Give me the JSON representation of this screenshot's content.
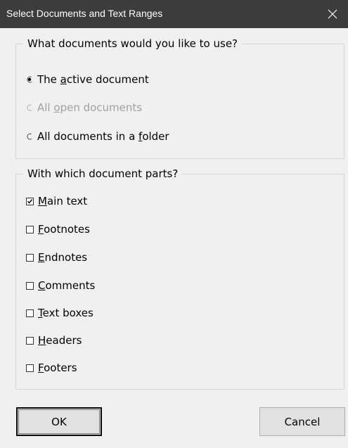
{
  "window": {
    "title": "Select Documents and Text Ranges",
    "close_glyph": "✕"
  },
  "documents_group": {
    "legend": "What documents would you like to use?",
    "options": [
      {
        "pre": "The ",
        "accel": "a",
        "post": "ctive document",
        "selected": true,
        "enabled": true
      },
      {
        "pre": "All ",
        "accel": "o",
        "post": "pen documents",
        "selected": false,
        "enabled": false
      },
      {
        "pre": "All documents in a ",
        "accel": "f",
        "post": "older",
        "selected": false,
        "enabled": true
      }
    ]
  },
  "parts_group": {
    "legend": "With which document parts?",
    "items": [
      {
        "pre": "",
        "accel": "M",
        "post": "ain text",
        "checked": true
      },
      {
        "pre": "",
        "accel": "F",
        "post": "ootnotes",
        "checked": false
      },
      {
        "pre": "",
        "accel": "E",
        "post": "ndnotes",
        "checked": false
      },
      {
        "pre": "",
        "accel": "C",
        "post": "omments",
        "checked": false
      },
      {
        "pre": "",
        "accel": "T",
        "post": "ext boxes",
        "checked": false
      },
      {
        "pre": "",
        "accel": "H",
        "post": "eaders",
        "checked": false
      },
      {
        "pre": "",
        "accel": "F",
        "post": "ooters",
        "checked": false
      }
    ]
  },
  "buttons": {
    "ok_label": "OK",
    "cancel_label": "Cancel"
  },
  "colors": {
    "titlebar": "#3c3c3c",
    "dialog_bg": "#f0f0f0",
    "disabled_text": "#a0a0a0"
  }
}
